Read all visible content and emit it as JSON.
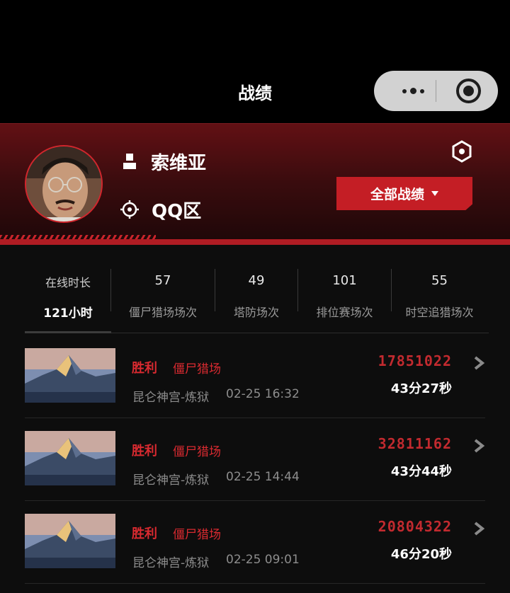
{
  "header": {
    "title": "战绩"
  },
  "capsule": {
    "more_icon": "more-dots-icon",
    "close_icon": "close-target-icon"
  },
  "profile": {
    "name": "索维亚",
    "region": "QQ区",
    "filter_label": "全部战绩",
    "accent": "#c41e25"
  },
  "stats": [
    {
      "value": "在线时长",
      "label": "121小时"
    },
    {
      "value": "57",
      "label": "僵尸猎场场次"
    },
    {
      "value": "49",
      "label": "塔防场次"
    },
    {
      "value": "101",
      "label": "排位赛场次"
    },
    {
      "value": "55",
      "label": "时空追猎场次"
    }
  ],
  "records": [
    {
      "result": "胜利",
      "mode": "僵尸猎场",
      "map": "昆仑神宫-炼狱",
      "time": "02-25 16:32",
      "score": "17851022",
      "duration": "43分27秒"
    },
    {
      "result": "胜利",
      "mode": "僵尸猎场",
      "map": "昆仑神宫-炼狱",
      "time": "02-25 14:44",
      "score": "32811162",
      "duration": "43分44秒"
    },
    {
      "result": "胜利",
      "mode": "僵尸猎场",
      "map": "昆仑神宫-炼狱",
      "time": "02-25 09:01",
      "score": "20804322",
      "duration": "46分20秒"
    }
  ]
}
